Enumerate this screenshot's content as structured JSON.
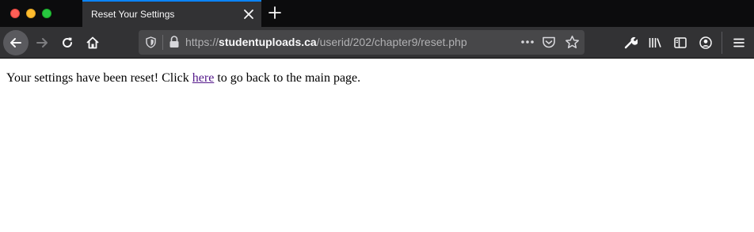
{
  "tab": {
    "title": "Reset Your Settings"
  },
  "url": {
    "scheme": "https://",
    "host": "studentuploads.ca",
    "path": "/userid/202/chapter9/reset.php"
  },
  "page": {
    "message_before": "Your settings have been reset! Click ",
    "link_text": "here",
    "message_after": " to go back to the main page."
  },
  "colors": {
    "tab_accent": "#0a84ff",
    "visited_link": "#551a8b",
    "toolbar_bg": "#323234",
    "tabstrip_bg": "#0c0c0d"
  },
  "icons": {
    "window": [
      "close-dot-icon",
      "minimize-dot-icon",
      "maximize-dot-icon"
    ],
    "tab": [
      "tab-close-icon",
      "new-tab-icon"
    ],
    "nav": [
      "back-arrow-icon",
      "forward-arrow-icon",
      "reload-icon",
      "home-icon"
    ],
    "urlbar": [
      "tracking-shield-icon",
      "lock-icon",
      "more-dots-icon",
      "pocket-icon",
      "star-icon"
    ],
    "toolbar": [
      "wrench-icon",
      "library-icon",
      "sidebar-icon",
      "account-icon",
      "hamburger-menu-icon"
    ]
  }
}
